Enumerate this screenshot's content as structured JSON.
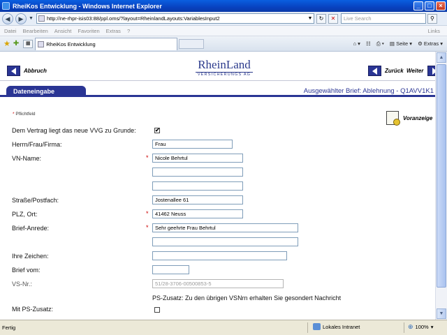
{
  "window": {
    "title": "RheiKos Entwicklung - Windows Internet Explorer"
  },
  "address": {
    "url": "http://ne-rhpr-isis03:88/ppl.oms/?layout=RheinlandLayouts:VariablesInput2",
    "search_placeholder": "Live Search"
  },
  "menu": {
    "items": [
      "Datei",
      "Bearbeiten",
      "Ansicht",
      "Favoriten",
      "Extras",
      "?"
    ],
    "links": "Links"
  },
  "tabs": {
    "active": "RheiKos Entwicklung"
  },
  "toolbar": {
    "page": "Seite",
    "extras": "Extras"
  },
  "header": {
    "back": "Abbruch",
    "prev": "Zurück",
    "next": "Weiter",
    "logo_brand": "RheinLand",
    "logo_sub": "VERSICHERUNGS AG"
  },
  "section": {
    "tab_label": "Dateneingabe",
    "selected_letter": "Ausgewählter Brief: Ablehnung - Q1AVV1K1"
  },
  "form": {
    "required_note": "Pflichtfeld",
    "preview_label": "Voranzeige",
    "vvg_label": "Dem Vertrag liegt das neue VVG zu Grunde:",
    "vvg_checked": "✔",
    "anrede_label": "Herrn/Frau/Firma:",
    "anrede_value": "Frau",
    "vn_name_label": "VN-Name:",
    "vn_name_1": "Nicole Behrtul",
    "vn_name_2": "",
    "vn_name_3": "",
    "strasse_label": "Straße/Postfach:",
    "strasse_value": "Jostenallee 61",
    "plz_label": "PLZ, Ort:",
    "plz_value": "41462 Neuss",
    "briefanrede_label": "Brief-Anrede:",
    "briefanrede_1": "Sehr geehrte Frau Behrtul",
    "briefanrede_2": "",
    "zeichen_label": "Ihre Zeichen:",
    "zeichen_value": "",
    "briefvom_label": "Brief vom:",
    "briefvom_value": "",
    "vsnr_label": "VS-Nr.:",
    "vsnr_value": "51/28-3706-00500853-5",
    "ps_info": "PS-Zusatz: Zu den übrigen VSNrn erhalten Sie gesondert Nachricht",
    "ps_label": "Mit PS-Zusatz:"
  },
  "status": {
    "text": "Fertig",
    "zone": "Lokales Intranet",
    "zoom": "100%"
  }
}
